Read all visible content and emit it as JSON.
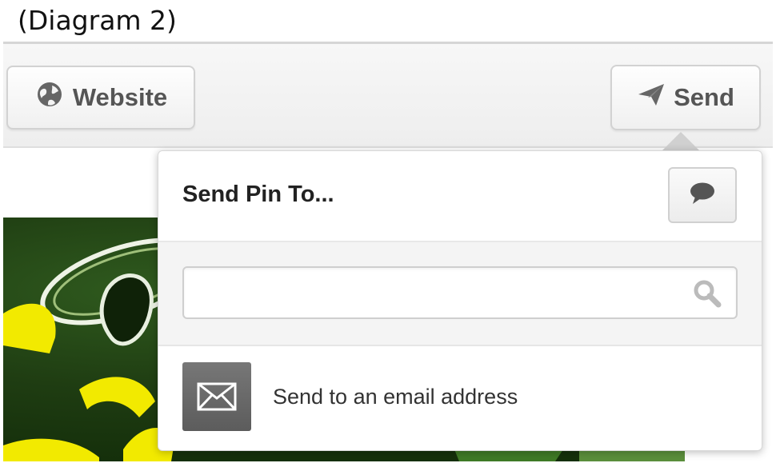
{
  "caption": "(Diagram 2)",
  "toolbar": {
    "website_label": "Website",
    "website_icon": "globe-icon",
    "send_label": "Send",
    "send_icon": "paper-plane-icon"
  },
  "popover": {
    "title": "Send Pin To...",
    "message_icon": "speech-bubble-icon",
    "search": {
      "value": "",
      "placeholder": "",
      "icon": "magnifier-icon"
    },
    "email_option": {
      "label": "Send to an email address",
      "icon": "envelope-icon"
    }
  },
  "colors": {
    "accent_yellow": "#f2ea00",
    "image_green": "#1f3d12",
    "button_text": "#555555",
    "tile_gray": "#666666"
  }
}
